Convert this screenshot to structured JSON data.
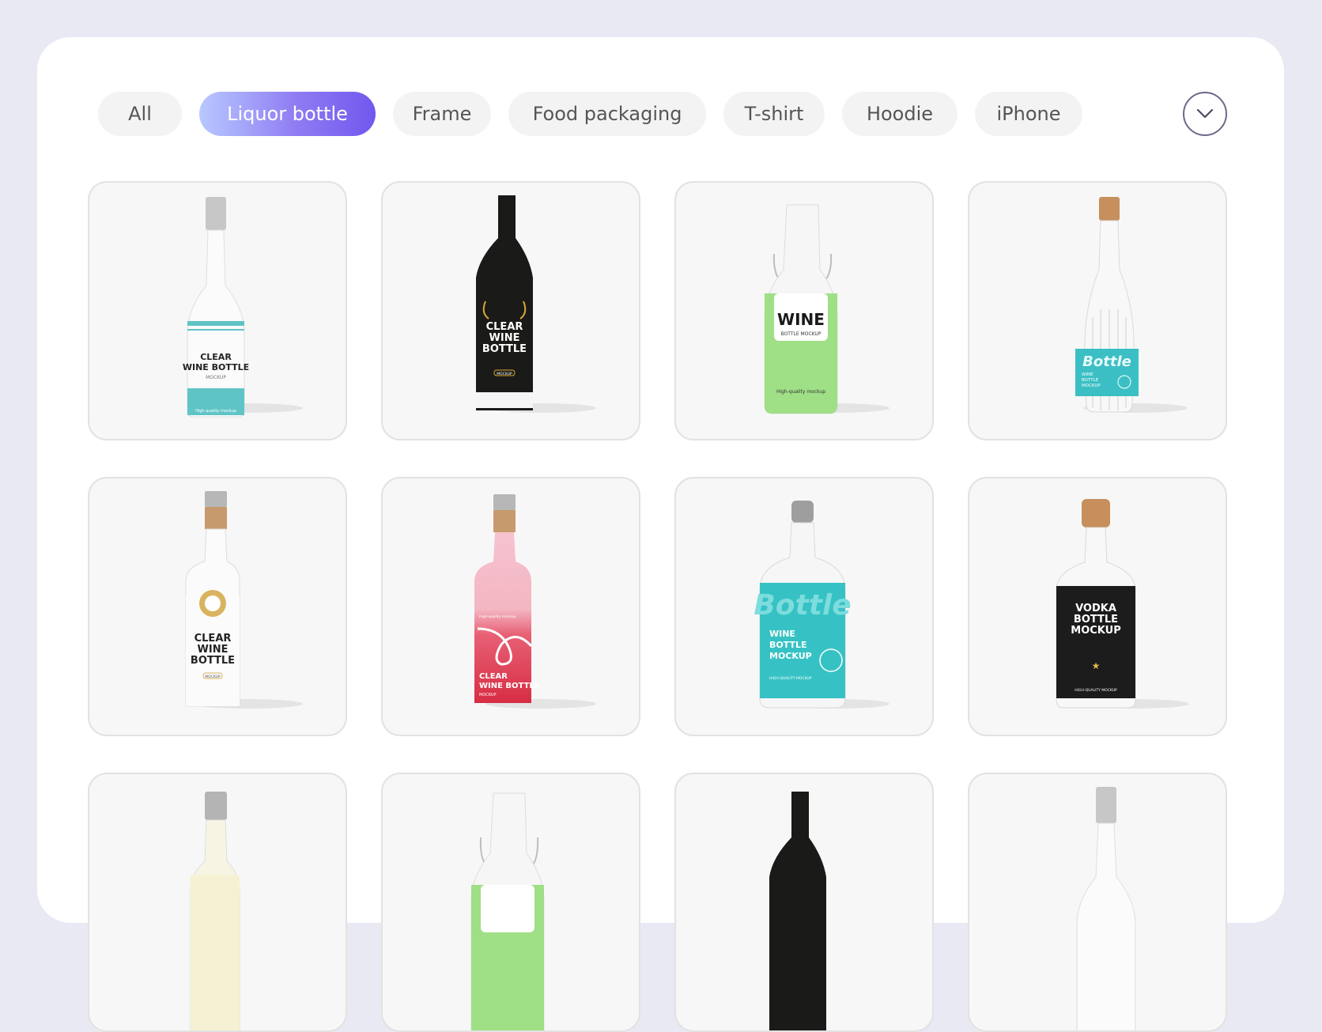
{
  "filters": {
    "chips": [
      "All",
      "Liquor bottle",
      "Frame",
      "Food packaging",
      "T-shirt",
      "Hoodie",
      "iPhone"
    ],
    "active": "Liquor bottle"
  },
  "dropdown": {
    "icon": "chevron-down-icon"
  },
  "cards": [
    {
      "name": "card-clear-wine-bottle-teal",
      "lines": [
        "CLEAR",
        "WINE BOTTLE",
        "MOCKUP"
      ],
      "tagline": "High-quality mockup"
    },
    {
      "name": "card-dark-wine-bottle",
      "lines": [
        "CLEAR",
        "WINE",
        "BOTTLE"
      ],
      "tagline": "MOCKUP"
    },
    {
      "name": "card-green-wine-bottle",
      "lines": [
        "WINE",
        "BOTTLE MOCKUP"
      ],
      "tagline": "High-quality mockup"
    },
    {
      "name": "card-ribbed-bottle",
      "lines": [
        "Bottle",
        "WINE",
        "BOTTLE",
        "MOCKUP"
      ],
      "tagline": ""
    },
    {
      "name": "card-clear-wine-bottle-cork",
      "lines": [
        "CLEAR",
        "WINE",
        "BOTTLE"
      ],
      "tagline": "MOCKUP"
    },
    {
      "name": "card-pink-wine-bottle",
      "lines": [
        "CLEAR",
        "WINE BOTTLE",
        "MOCKUP"
      ],
      "tagline": "High-quality mockup"
    },
    {
      "name": "card-teal-bottle",
      "lines": [
        "Bottle",
        "WINE",
        "BOTTLE",
        "MOCKUP"
      ],
      "tagline": "HIGH-QUALITY MOCKUP"
    },
    {
      "name": "card-vodka-bottle",
      "lines": [
        "VODKA",
        "BOTTLE",
        "MOCKUP"
      ],
      "tagline": "HIGH-QUALITY MOCKUP"
    },
    {
      "name": "card-yellow-bottle",
      "lines": [],
      "tagline": ""
    },
    {
      "name": "card-swing-top-bottle",
      "lines": [],
      "tagline": ""
    },
    {
      "name": "card-dark-bottle-2",
      "lines": [],
      "tagline": ""
    },
    {
      "name": "card-clear-bottle-2",
      "lines": [],
      "tagline": ""
    }
  ]
}
